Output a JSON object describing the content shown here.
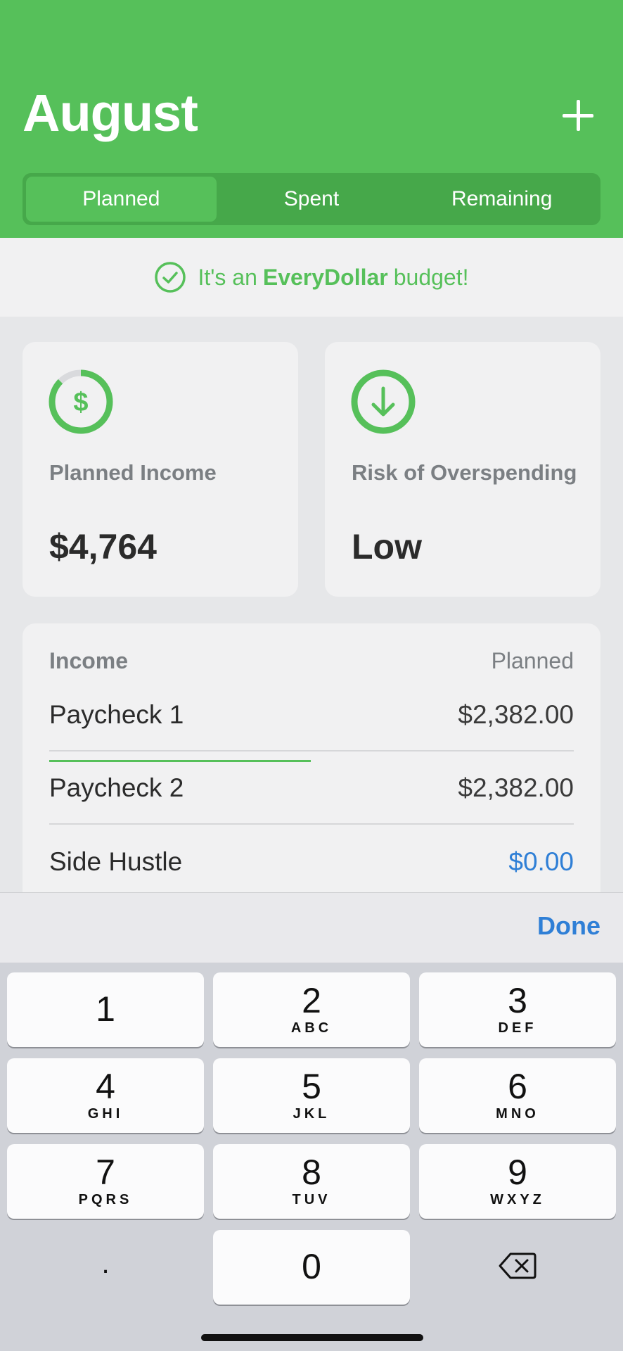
{
  "header": {
    "title": "August",
    "add_icon": "plus-icon",
    "tabs": [
      {
        "label": "Planned",
        "active": true
      },
      {
        "label": "Spent",
        "active": false
      },
      {
        "label": "Remaining",
        "active": false
      }
    ]
  },
  "banner": {
    "prefix": "It's an",
    "brand": "EveryDollar",
    "suffix": "budget!",
    "icon": "check-circle-icon"
  },
  "summary": {
    "income_label": "Planned Income",
    "income_value": "$4,764",
    "income_icon": "dollar-ring-icon",
    "risk_label": "Risk of Overspending",
    "risk_value": "Low",
    "risk_icon": "down-arrow-circle-icon"
  },
  "income": {
    "header_left": "Income",
    "header_right": "Planned",
    "rows": [
      {
        "name": "Paycheck 1",
        "amount": "$2,382.00"
      },
      {
        "name": "Paycheck 2",
        "amount": "$2,382.00"
      },
      {
        "name": "Side Hustle",
        "amount": "$0.00"
      }
    ]
  },
  "accessory": {
    "done_label": "Done"
  },
  "keypad": {
    "keys": [
      {
        "num": "1",
        "letters": ""
      },
      {
        "num": "2",
        "letters": "ABC"
      },
      {
        "num": "3",
        "letters": "DEF"
      },
      {
        "num": "4",
        "letters": "GHI"
      },
      {
        "num": "5",
        "letters": "JKL"
      },
      {
        "num": "6",
        "letters": "MNO"
      },
      {
        "num": "7",
        "letters": "PQRS"
      },
      {
        "num": "8",
        "letters": "TUV"
      },
      {
        "num": "9",
        "letters": "WXYZ"
      },
      {
        "num": ".",
        "letters": ""
      },
      {
        "num": "0",
        "letters": ""
      }
    ],
    "delete_icon": "backspace-icon"
  },
  "colors": {
    "brand_green": "#56c05a",
    "segment_bg": "#46a84a",
    "link_blue": "#2f7fd6"
  }
}
